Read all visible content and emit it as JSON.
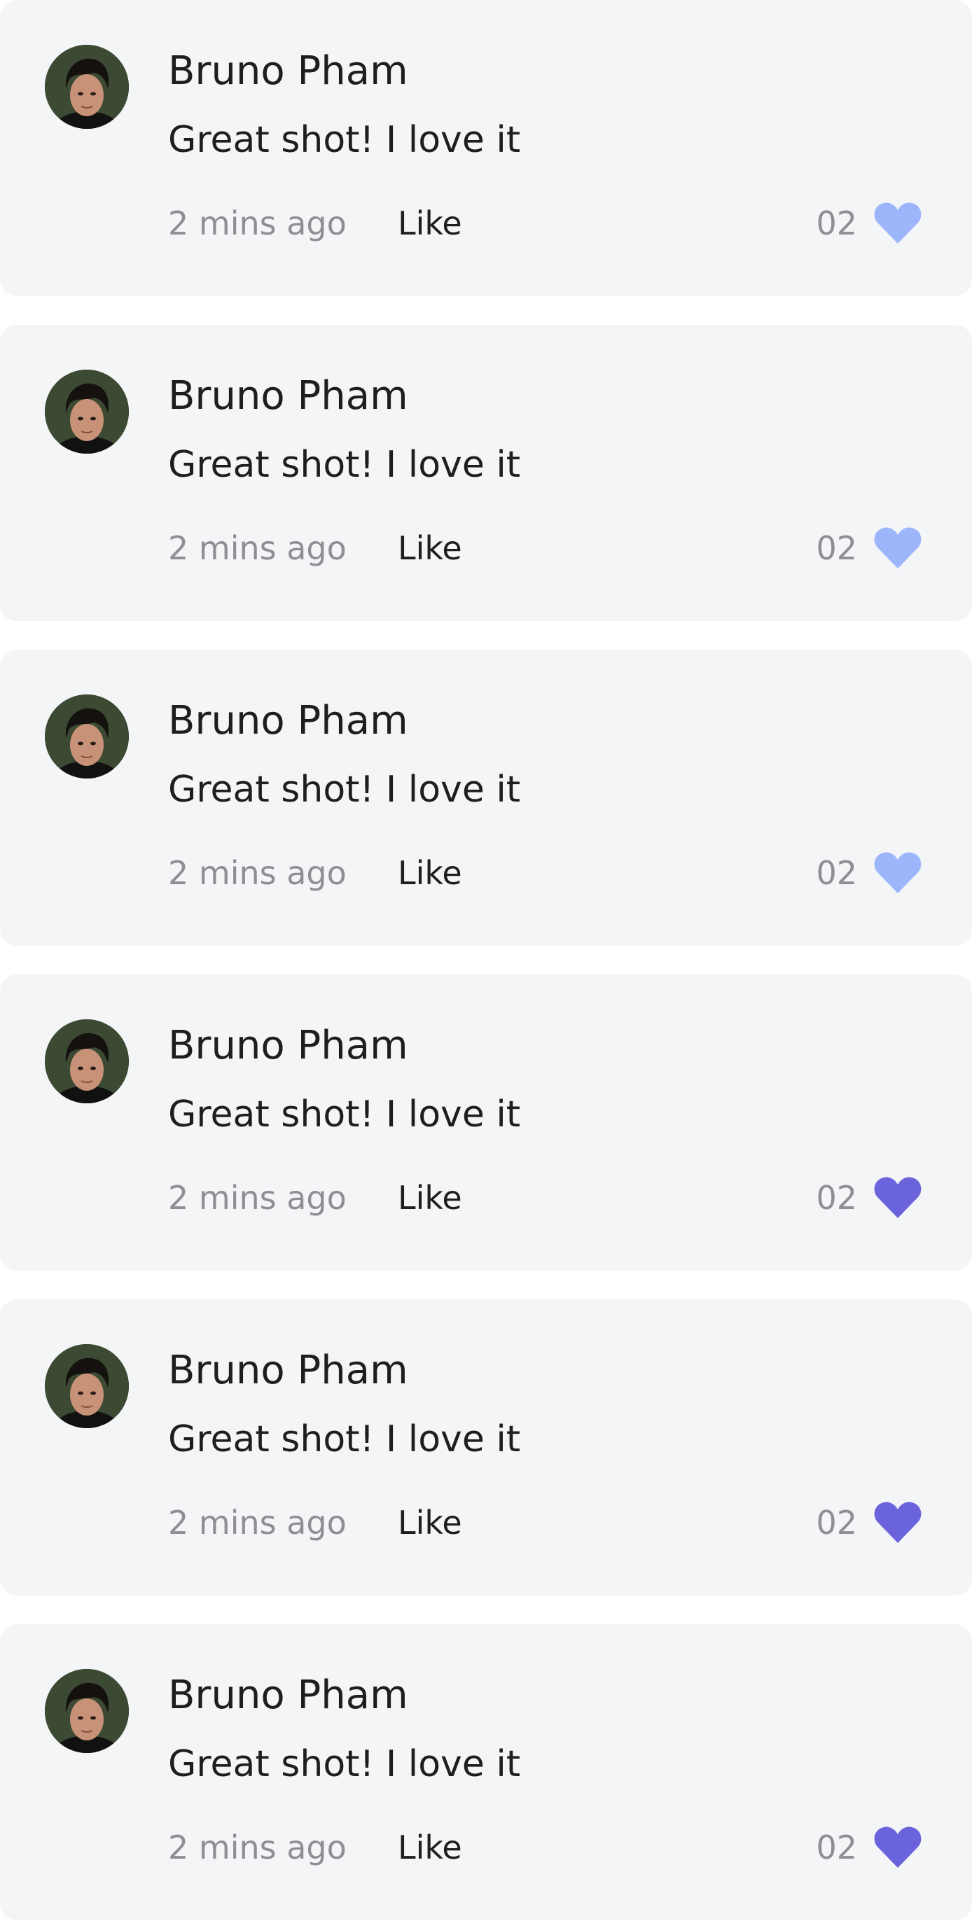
{
  "comments": [
    {
      "author": "Bruno Pham",
      "text": "Great shot! I love it",
      "time": "2 mins ago",
      "like_label": "Like",
      "likes": "02",
      "liked": false
    },
    {
      "author": "Bruno Pham",
      "text": "Great shot! I love it",
      "time": "2 mins ago",
      "like_label": "Like",
      "likes": "02",
      "liked": false
    },
    {
      "author": "Bruno Pham",
      "text": "Great shot! I love it",
      "time": "2 mins ago",
      "like_label": "Like",
      "likes": "02",
      "liked": false
    },
    {
      "author": "Bruno Pham",
      "text": "Great shot! I love it",
      "time": "2 mins ago",
      "like_label": "Like",
      "likes": "02",
      "liked": true
    },
    {
      "author": "Bruno Pham",
      "text": "Great shot! I love it",
      "time": "2 mins ago",
      "like_label": "Like",
      "likes": "02",
      "liked": true
    },
    {
      "author": "Bruno Pham",
      "text": "Great shot! I love it",
      "time": "2 mins ago",
      "like_label": "Like",
      "likes": "02",
      "liked": true
    }
  ],
  "colors": {
    "card_background": "#f4f5f7",
    "heart_inactive": "#9db5fb",
    "heart_active": "#6b63db",
    "text_primary": "#1d1e20",
    "text_secondary": "#8e8f93"
  }
}
